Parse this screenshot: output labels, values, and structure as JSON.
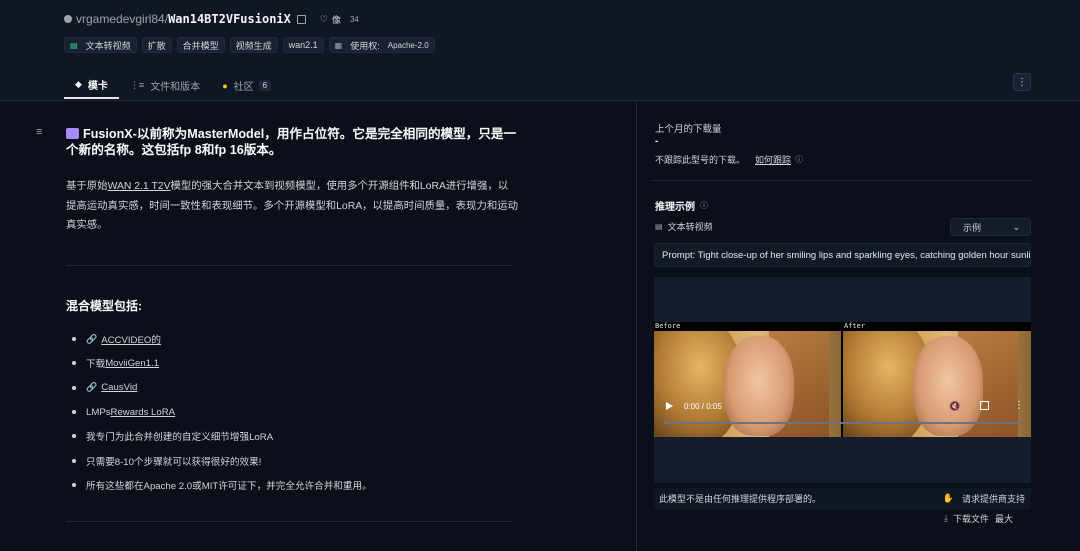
{
  "repo": {
    "owner": "vrgamedevgirl84",
    "separator": "/",
    "name": "Wan14BT2VFusioniX",
    "like_label": "像",
    "like_count": "34"
  },
  "tags": [
    {
      "label": "文本转视频",
      "icon": "text-to-video-icon"
    },
    {
      "label": "扩散"
    },
    {
      "label": "合并模型"
    },
    {
      "label": "视频生成"
    },
    {
      "label": "wan2.1"
    }
  ],
  "license": {
    "label": "使用权:",
    "value": "Apache-2.0"
  },
  "tabs": [
    {
      "label": "模卡",
      "icon": "model-card-icon",
      "active": true
    },
    {
      "label": "文件和版本",
      "icon": "files-icon"
    },
    {
      "label": "社区",
      "icon": "community-icon",
      "badge": "6"
    }
  ],
  "content": {
    "heading": "FusionX-以前称为MasterModel，用作占位符。它是完全相同的模型，只是一个新的名称。这包括fp 8和fp 16版本。",
    "intro_prefix": "基于原始",
    "intro_link": "WAN 2.1 T2V",
    "intro_suffix": "模型的强大合并文本到视频模型，使用多个开源组件和LoRA进行增强，以提高运动真实感，时间一致性和表现细节。多个开源模型和LoRA，以提高时间质量，表现力和运动真实感。",
    "subheading": "混合模型包括:",
    "bullets": {
      "b1_link": "ACCVIDEO的",
      "b2_prefix": "下载",
      "b2_link": "MoviiGen1.1",
      "b3_link": "CausVid",
      "b4_prefix": "LMPs",
      "b4_link": "Rewards LoRA",
      "b5": "我专门为此合并创建的自定义细节增强LoRA",
      "b6": "只需要8-10个步骤就可以获得很好的效果!",
      "b7": "所有这些都在Apache 2.0或MIT许可证下，并完全允许合并和重用。"
    }
  },
  "sidebar": {
    "downloads_label": "上个月的下载量",
    "downloads_value": "-",
    "downloads_note": "不跟踪此型号的下载。",
    "learn_more": "如何跟踪",
    "inference_title": "推理示例",
    "task_label": "文本转视频",
    "examples_label": "示例",
    "prompt": "Prompt: Tight close-up of her smiling lips and sparkling eyes, catching golden hour sunlight",
    "before_label": "Before",
    "after_label": "After",
    "video_time": "0:00 / 0:05",
    "video_progress": 0.0,
    "no_provider": "此模型不是由任何推理提供程序部署的。",
    "request_provider": "请求提供商支持",
    "download_files": "下载文件",
    "max_label": "最大"
  }
}
